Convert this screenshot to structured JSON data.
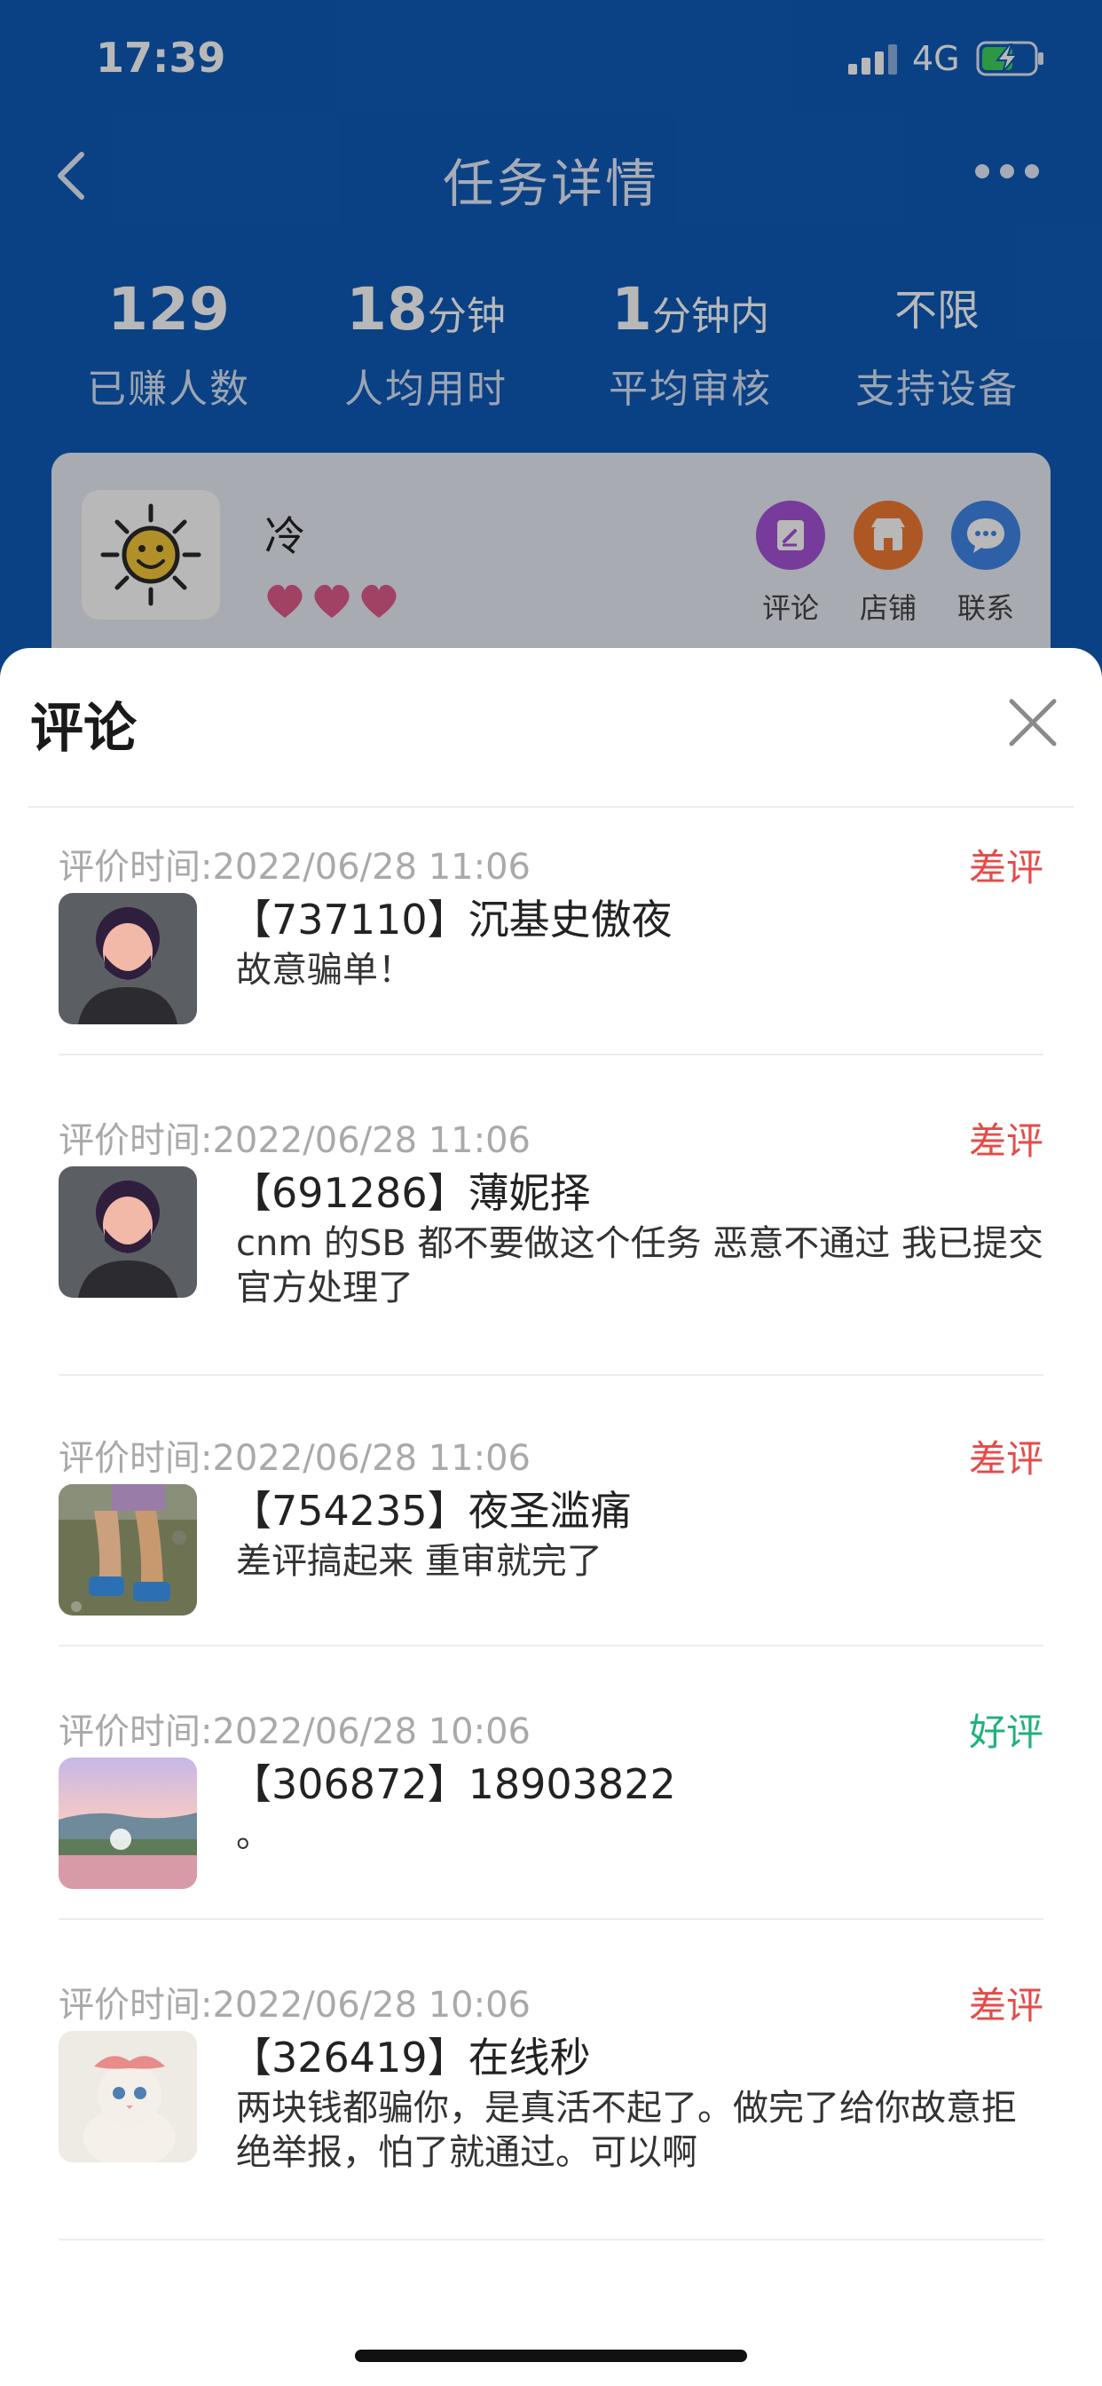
{
  "status_bar": {
    "time": "17:39",
    "network": "4G"
  },
  "nav": {
    "title": "任务详情"
  },
  "stats": [
    {
      "number": "129",
      "unit": "",
      "label": "已赚人数"
    },
    {
      "number": "18",
      "unit": "分钟",
      "label": "人均用时"
    },
    {
      "number": "1",
      "unit": "分钟内",
      "label": "平均审核"
    },
    {
      "number": "",
      "unit": "不限",
      "label": "支持设备"
    }
  ],
  "shop": {
    "name": "冷",
    "hearts": 3,
    "actions": [
      {
        "label": "评论",
        "icon": "edit-icon",
        "color": "#a552d8"
      },
      {
        "label": "店铺",
        "icon": "store-icon",
        "color": "#f07a32"
      },
      {
        "label": "联系",
        "icon": "chat-icon",
        "color": "#3f86e8"
      }
    ]
  },
  "sheet": {
    "title": "评论",
    "reviews": [
      {
        "time": "评价时间:2022/06/28 11:06",
        "rating": "差评",
        "rating_type": "bad",
        "user": "【737110】沉基史傲夜",
        "content": "故意骗单！",
        "avatar": "default-man"
      },
      {
        "time": "评价时间:2022/06/28 11:06",
        "rating": "差评",
        "rating_type": "bad",
        "user": "【691286】薄妮择",
        "content": "cnm  的SB  都不要做这个任务   恶意不通过  我已提交官方处理了",
        "avatar": "default-man"
      },
      {
        "time": "评价时间:2022/06/28 11:06",
        "rating": "差评",
        "rating_type": "bad",
        "user": "【754235】夜圣滥痛",
        "content": "差评搞起来 重审就完了",
        "avatar": "child-feet-photo"
      },
      {
        "time": "评价时间:2022/06/28 10:06",
        "rating": "好评",
        "rating_type": "good",
        "user": "【306872】18903822",
        "content": "。",
        "avatar": "sunset-photo"
      },
      {
        "time": "评价时间:2022/06/28 10:06",
        "rating": "差评",
        "rating_type": "bad",
        "user": "【326419】在线秒",
        "content": "两块钱都骗你，是真活不起了。做完了给你故意拒绝举报，怕了就通过。可以啊",
        "avatar": "cat-photo"
      }
    ]
  }
}
